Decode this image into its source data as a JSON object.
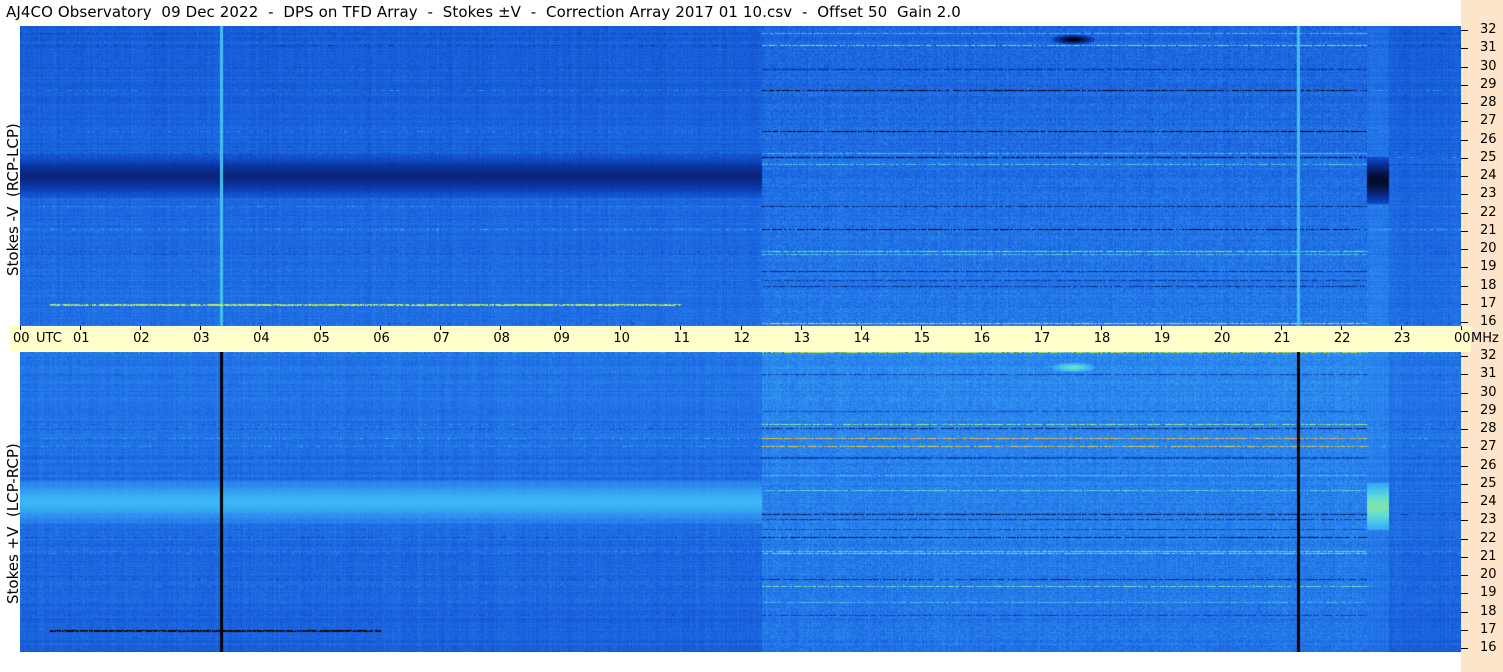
{
  "title": "AJ4CO Observatory  09 Dec 2022  -  DPS on TFD Array  -  Stokes ±V  -  Correction Array 2017 01 10.csv  -  Offset 50  Gain 2.0",
  "colors": {
    "time_axis_bg": "#ffffcc",
    "freq_axis_bg": "#fde5cc",
    "colormap": [
      "#000000",
      "#0a1f6e",
      "#0b3fb8",
      "#1a64e0",
      "#2e8cf0",
      "#3cb8f5",
      "#66e0d0",
      "#c8f04a",
      "#ffa030"
    ]
  },
  "chart_data": [
    {
      "type": "heatmap",
      "panel": "top",
      "ylabel": "Stokes -V  (RCP-LCP)",
      "xlabel": "UTC",
      "x_unit": "UTC",
      "y_unit": "MHz",
      "x_range": [
        0,
        24
      ],
      "y_range": [
        16,
        32
      ],
      "x_ticks": [
        "00",
        "01",
        "02",
        "03",
        "04",
        "05",
        "06",
        "07",
        "08",
        "09",
        "10",
        "11",
        "12",
        "13",
        "14",
        "15",
        "16",
        "17",
        "18",
        "19",
        "20",
        "21",
        "22",
        "23",
        "00"
      ],
      "y_ticks": [
        "32",
        "31",
        "30",
        "29",
        "28",
        "27",
        "26",
        "25",
        "24",
        "23",
        "22",
        "21",
        "20",
        "19",
        "18",
        "17",
        "16"
      ],
      "baseline_level": 0.38,
      "daytime_start_utc": 12.35,
      "notable_features": [
        {
          "kind": "dark band",
          "utc": [
            0,
            12.35
          ],
          "mhz": [
            22.8,
            25.2
          ],
          "level": 0.15
        },
        {
          "kind": "vertical line",
          "utc": 3.35,
          "level": 0.65
        },
        {
          "kind": "vertical line",
          "utc": 21.3,
          "level": 0.65
        },
        {
          "kind": "storm column",
          "utc": [
            22.45,
            22.8
          ],
          "mhz": [
            22.5,
            25
          ],
          "level": 0.05
        },
        {
          "kind": "blob",
          "utc": 17.55,
          "mhz": 31.3,
          "level": 0.0
        },
        {
          "kind": "hot row",
          "mhz": 17.1,
          "utc": [
            0.5,
            11
          ],
          "level": 0.85
        }
      ]
    },
    {
      "type": "heatmap",
      "panel": "bottom",
      "ylabel": "Stokes +V  (LCP-RCP)",
      "xlabel": "UTC",
      "x_unit": "UTC",
      "y_unit": "MHz",
      "x_range": [
        0,
        24
      ],
      "y_range": [
        16,
        32
      ],
      "y_ticks": [
        "32",
        "31",
        "30",
        "29",
        "28",
        "27",
        "26",
        "25",
        "24",
        "23",
        "22",
        "21",
        "20",
        "19",
        "18",
        "17",
        "16"
      ],
      "baseline_level": 0.4,
      "daytime_start_utc": 12.35,
      "notable_features": [
        {
          "kind": "bright band",
          "utc": [
            0,
            12.35
          ],
          "mhz": [
            22.8,
            25.2
          ],
          "level": 0.62
        },
        {
          "kind": "vertical line",
          "utc": 3.35,
          "level": 0.0
        },
        {
          "kind": "vertical line",
          "utc": 21.3,
          "level": 0.0
        },
        {
          "kind": "storm column",
          "utc": [
            22.45,
            22.8
          ],
          "mhz": [
            22.5,
            25
          ],
          "level": 0.78
        },
        {
          "kind": "blob",
          "utc": 17.55,
          "mhz": 31.2,
          "level": 0.75
        },
        {
          "kind": "dark row",
          "mhz": 17.1,
          "utc": [
            0.5,
            6
          ],
          "level": 0.0
        }
      ]
    }
  ]
}
